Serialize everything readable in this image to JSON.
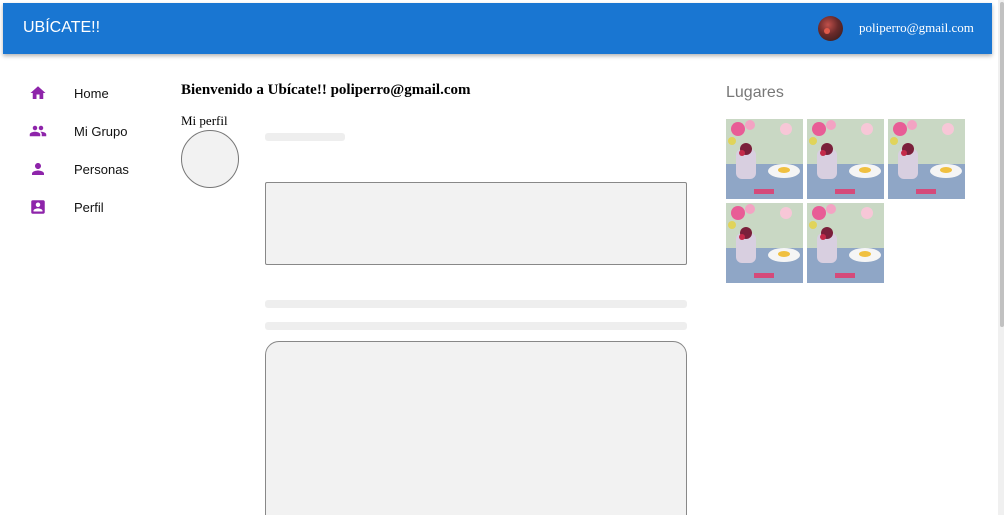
{
  "appbar": {
    "title": "UBÍCATE!!",
    "user_email": "poliperro@gmail.com",
    "color": "#1976d2"
  },
  "nav": {
    "icon_color": "#8e24aa",
    "items": [
      {
        "label": "Home",
        "icon": "home-icon"
      },
      {
        "label": "Mi Grupo",
        "icon": "group-icon"
      },
      {
        "label": "Personas",
        "icon": "person-icon"
      },
      {
        "label": "Perfil",
        "icon": "account-box-icon"
      }
    ]
  },
  "main": {
    "welcome": "Bienvenido a Ubícate!! poliperro@gmail.com",
    "profile_label": "Mi perfil"
  },
  "places": {
    "title": "Lugares",
    "thumbnail_count": 5
  }
}
